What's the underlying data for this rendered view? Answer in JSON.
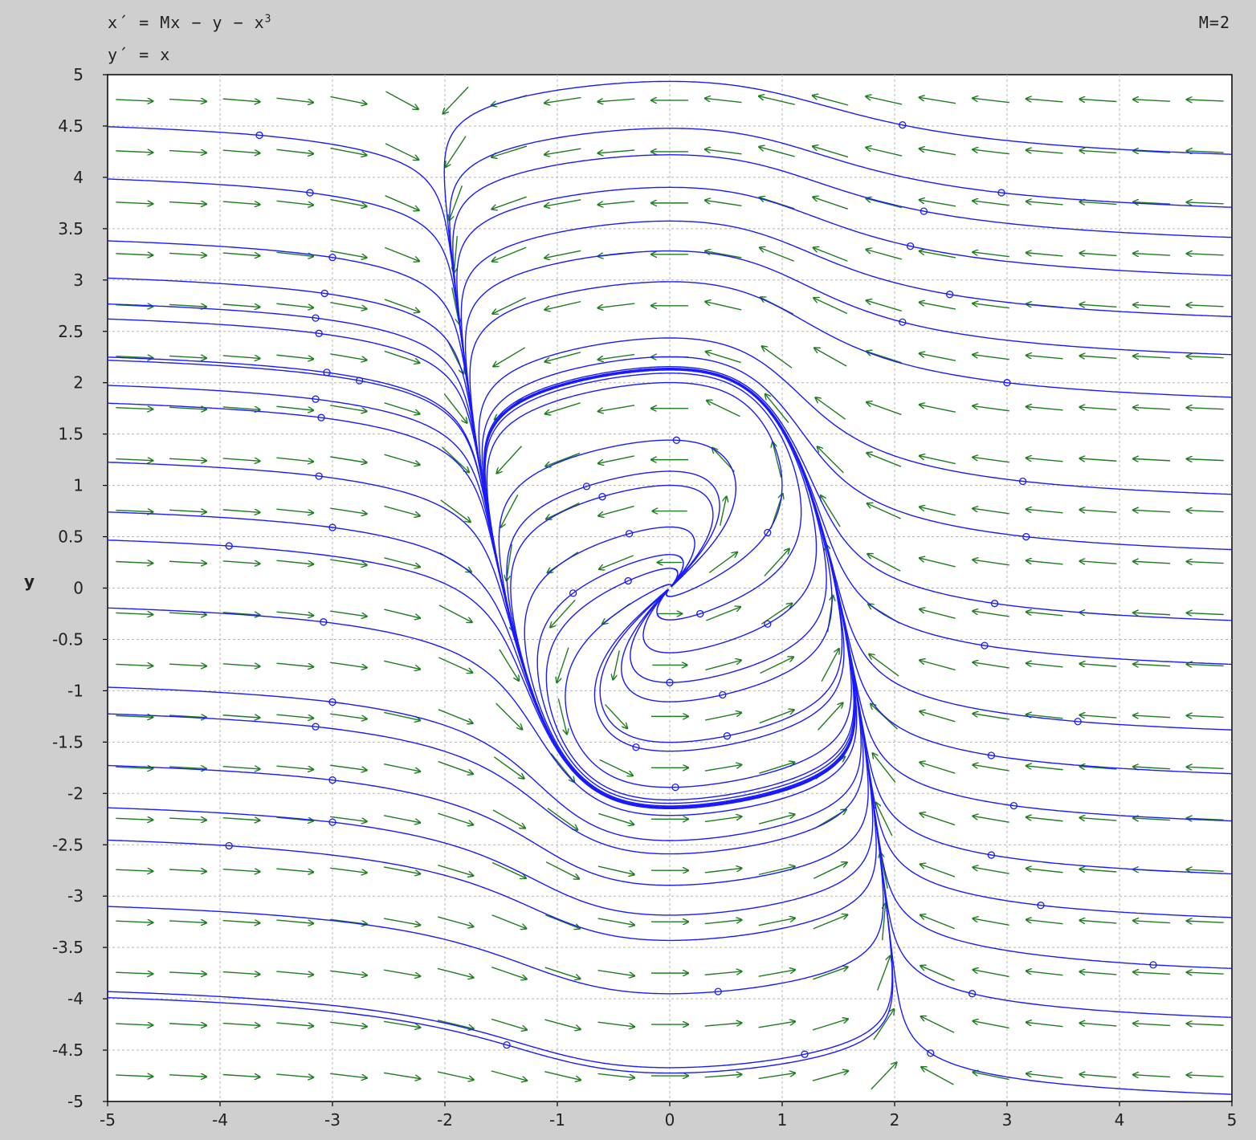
{
  "header": {
    "equation_x_prefix": "x´ = Mx − y − x",
    "equation_x_power": "3",
    "equation_y": "y´ = x",
    "parameter": "M=2"
  },
  "colors": {
    "background": "#cfcfcf",
    "plot_area": "#ffffff",
    "trajectory": "#1a1aff",
    "direction_field": "#1e7d1e",
    "grid": "#b4b4b4"
  },
  "chart_data": {
    "type": "phase_portrait",
    "system": {
      "dx": "M*x - y - x^3",
      "dy": "x",
      "M": 2
    },
    "xlabel": "",
    "ylabel": "y",
    "xlim": [
      -5,
      5
    ],
    "ylim": [
      -5,
      5
    ],
    "x_ticks": [
      "-5",
      "-4",
      "-3",
      "-2",
      "-1",
      "0",
      "1",
      "2",
      "3",
      "4",
      "5"
    ],
    "y_ticks": [
      "5",
      "4.5",
      "4",
      "3.5",
      "3",
      "2.5",
      "2",
      "1.5",
      "1",
      "0.5",
      "0",
      "-0.5",
      "-1",
      "-1.5",
      "-2",
      "-2.5",
      "-3",
      "-3.5",
      "-4",
      "-4.5",
      "-5"
    ],
    "grid": true,
    "direction_field": {
      "nx": 21,
      "ny": 20
    },
    "seeds": [
      [
        -3.65,
        4.41
      ],
      [
        2.07,
        4.51
      ],
      [
        -3.2,
        3.85
      ],
      [
        2.95,
        3.85
      ],
      [
        2.26,
        3.67
      ],
      [
        -3.0,
        3.22
      ],
      [
        2.14,
        3.33
      ],
      [
        -3.07,
        2.87
      ],
      [
        2.49,
        2.86
      ],
      [
        -3.15,
        2.63
      ],
      [
        -3.12,
        2.48
      ],
      [
        2.07,
        2.59
      ],
      [
        -3.05,
        2.1
      ],
      [
        -2.76,
        2.02
      ],
      [
        3.0,
        2.0
      ],
      [
        -3.15,
        1.84
      ],
      [
        -3.1,
        1.66
      ],
      [
        3.14,
        1.04
      ],
      [
        -3.12,
        1.09
      ],
      [
        0.06,
        1.44
      ],
      [
        -0.74,
        0.99
      ],
      [
        -0.6,
        0.89
      ],
      [
        3.17,
        0.5
      ],
      [
        -3.0,
        0.59
      ],
      [
        -3.92,
        0.41
      ],
      [
        0.87,
        0.54
      ],
      [
        -0.36,
        0.53
      ],
      [
        -0.37,
        0.07
      ],
      [
        -0.86,
        -0.05
      ],
      [
        0.27,
        -0.25
      ],
      [
        0.87,
        -0.35
      ],
      [
        2.89,
        -0.15
      ],
      [
        -3.08,
        -0.33
      ],
      [
        2.8,
        -0.56
      ],
      [
        0.0,
        -0.92
      ],
      [
        0.47,
        -1.04
      ],
      [
        -3.0,
        -1.11
      ],
      [
        -3.15,
        -1.35
      ],
      [
        0.51,
        -1.44
      ],
      [
        3.63,
        -1.3
      ],
      [
        -0.3,
        -1.55
      ],
      [
        2.86,
        -1.63
      ],
      [
        0.05,
        -1.94
      ],
      [
        -3.0,
        -1.87
      ],
      [
        3.06,
        -2.12
      ],
      [
        -3.0,
        -2.28
      ],
      [
        -3.92,
        -2.51
      ],
      [
        2.86,
        -2.6
      ],
      [
        3.3,
        -3.09
      ],
      [
        4.3,
        -3.67
      ],
      [
        0.43,
        -3.93
      ],
      [
        2.69,
        -3.95
      ],
      [
        -1.45,
        -4.45
      ],
      [
        1.2,
        -4.54
      ],
      [
        2.32,
        -4.53
      ]
    ]
  }
}
